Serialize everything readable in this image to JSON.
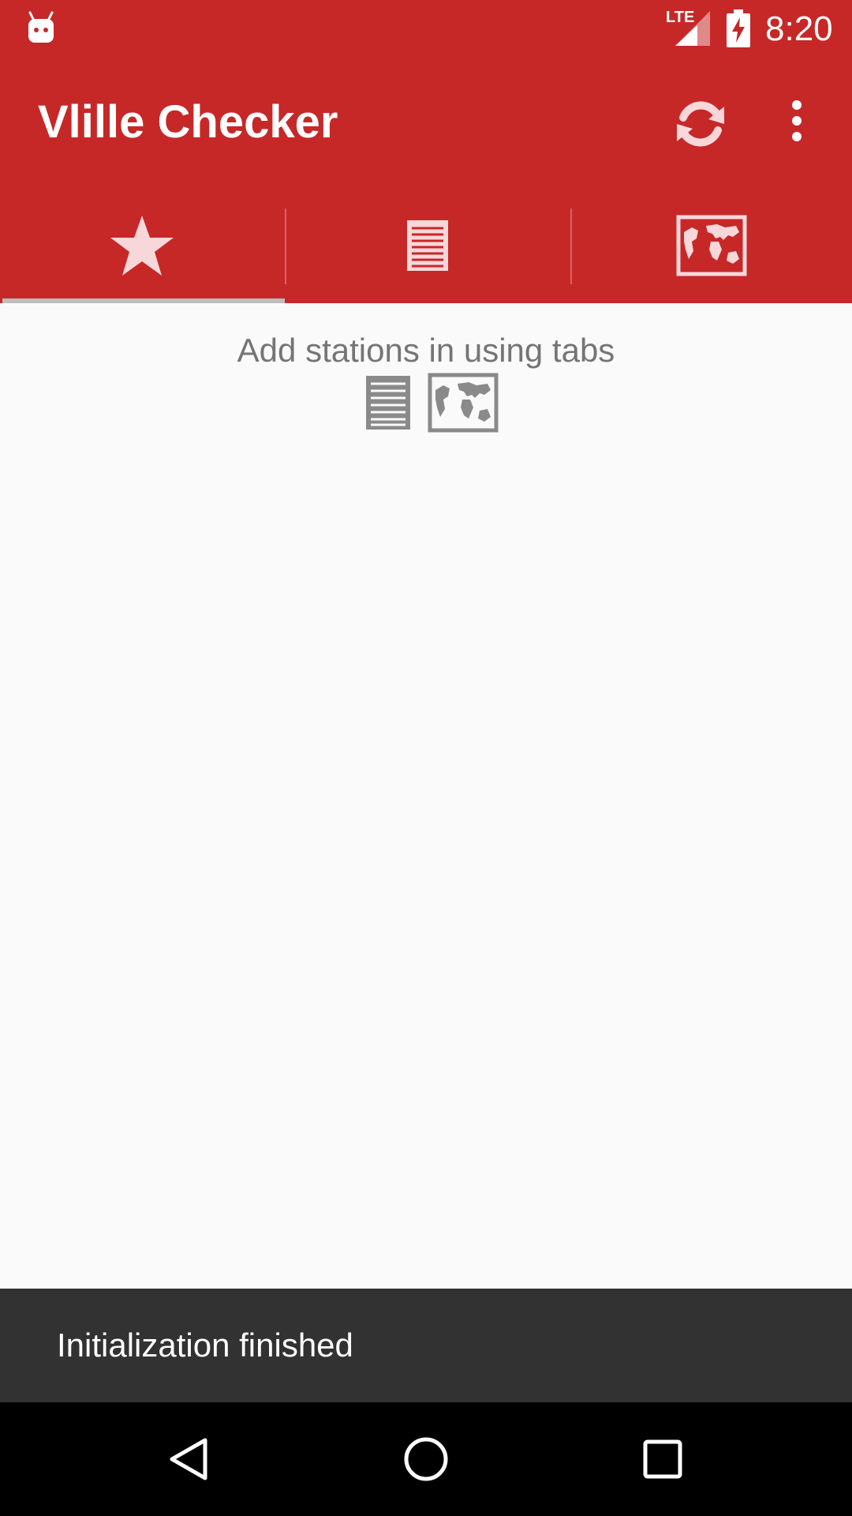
{
  "status_bar": {
    "network": "LTE",
    "time": "8:20",
    "icons": [
      "android-app-icon",
      "lte-signal-icon",
      "battery-charging-icon"
    ]
  },
  "app_bar": {
    "title": "Vlille Checker",
    "actions": [
      "refresh-icon",
      "overflow-menu-icon"
    ]
  },
  "tabs": {
    "selected_index": 0,
    "items": [
      {
        "icon": "star-icon"
      },
      {
        "icon": "list-icon"
      },
      {
        "icon": "map-icon"
      }
    ]
  },
  "content": {
    "hint": "Add stations in using tabs",
    "hint_icons": [
      "list-icon",
      "map-icon"
    ]
  },
  "snackbar": {
    "message": "Initialization finished"
  },
  "nav_bar": {
    "buttons": [
      "back-icon",
      "home-icon",
      "recents-icon"
    ]
  },
  "colors": {
    "primary": "#C62828",
    "tab_icon": "#F8D7DA",
    "hint_text": "#757575",
    "snackbar_bg": "#323232",
    "nav_bg": "#000000",
    "indicator": "#BDBDBD"
  }
}
